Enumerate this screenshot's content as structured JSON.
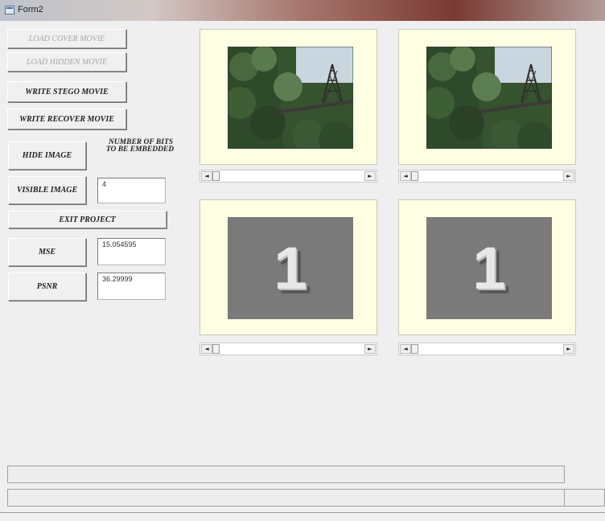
{
  "window": {
    "title": "Form2"
  },
  "buttons": {
    "load_cover": "LOAD COVER MOVIE",
    "load_hidden": "LOAD HIDDEN MOVIE",
    "write_stego": "WRITE STEGO MOVIE",
    "write_recover": "WRITE RECOVER MOVIE",
    "hide_image": "HIDE IMAGE",
    "visible_image": "VISIBLE IMAGE",
    "exit_project": "EXIT PROJECT",
    "mse": "MSE",
    "psnr": "PSNR"
  },
  "labels": {
    "bits_line1": "NUMBER OF BITS",
    "bits_line2": "TO BE EMBEDDED"
  },
  "fields": {
    "bits_value": "4",
    "mse_value": "15.054595",
    "psnr_value": "36.29999"
  },
  "frames": {
    "frame3_digit": "1",
    "frame4_digit": "1"
  },
  "scrollbars": {
    "left_arrow": "◄",
    "right_arrow": "►"
  },
  "icons": {
    "window_icon": "form-window-icon"
  }
}
